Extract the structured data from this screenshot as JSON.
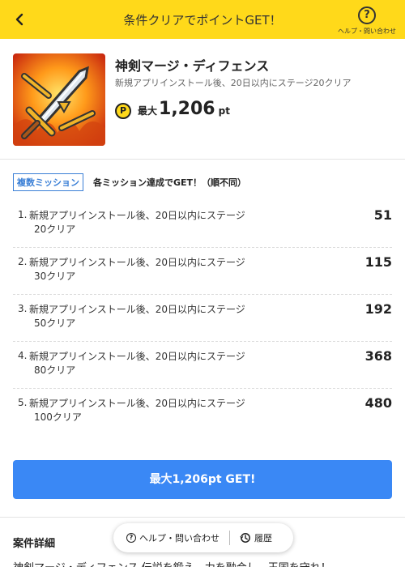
{
  "header": {
    "title": "条件クリアでポイントGET！",
    "help_label": "ヘルプ・問い合わせ",
    "help_icon_glyph": "?"
  },
  "app": {
    "name": "神剣マージ・ディフェンス",
    "subtitle": "新規アプリインストール後、20日以内にステージ20クリア",
    "coin_glyph": "P",
    "max_label": "最大",
    "max_points": "1,206",
    "points_unit": "pt"
  },
  "missions": {
    "badge": "複数ミッション",
    "note": "各ミッション達成でGET！（順不同）",
    "items": [
      {
        "num": "1.",
        "line1": "新規アプリインストール後、20日以内にステージ",
        "line2": "20クリア",
        "points": "51"
      },
      {
        "num": "2.",
        "line1": "新規アプリインストール後、20日以内にステージ",
        "line2": "30クリア",
        "points": "115"
      },
      {
        "num": "3.",
        "line1": "新規アプリインストール後、20日以内にステージ",
        "line2": "50クリア",
        "points": "192"
      },
      {
        "num": "4.",
        "line1": "新規アプリインストール後、20日以内にステージ",
        "line2": "80クリア",
        "points": "368"
      },
      {
        "num": "5.",
        "line1": "新規アプリインストール後、20日以内にステージ",
        "line2": "100クリア",
        "points": "480"
      }
    ]
  },
  "get_button_label": "最大1,206pt GET!",
  "details": {
    "title": "案件詳細",
    "text": "神剣マージ・ディフェンス 伝説を鍛え、力を融合し、王国を守れ！"
  },
  "float_bar": {
    "help_label": "ヘルプ・問い合わせ",
    "history_label": "履歴"
  },
  "colors": {
    "header_bg": "#ffd91a",
    "accent_blue": "#3a88f5",
    "badge_blue": "#3a7fd6"
  }
}
